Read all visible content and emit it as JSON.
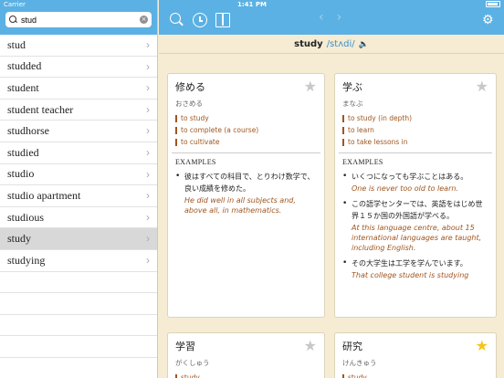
{
  "status": {
    "carrier": "Carrier",
    "time": "1:41 PM"
  },
  "search": {
    "value": "stud",
    "clear_glyph": "×"
  },
  "list_items": [
    "stud",
    "studded",
    "student",
    "student teacher",
    "studhorse",
    "studied",
    "studio",
    "studio apartment",
    "studious",
    "study",
    "studying"
  ],
  "selected_index": 9,
  "toolbar": {
    "back": "‹",
    "forward": "›",
    "gear": "⚙"
  },
  "word": {
    "headword": "study",
    "ipa": "/stʌdi/",
    "speaker": "🔈"
  },
  "cards": [
    {
      "head": "修める",
      "reading": "おさめる",
      "starred": false,
      "defs": [
        "to study",
        "to complete (a course)",
        "to cultivate"
      ],
      "examples_title": "EXAMPLES",
      "examples": [
        {
          "jp": "彼はすべての科目で、とりわけ数学で、良い成績を修めた。",
          "en": "He did well in all subjects and, above all, in mathematics."
        }
      ]
    },
    {
      "head": "学ぶ",
      "reading": "まなぶ",
      "starred": false,
      "defs": [
        "to study (in depth)",
        "to learn",
        "to take lessons in"
      ],
      "examples_title": "EXAMPLES",
      "examples": [
        {
          "jp": "いくつになっても学ぶことはある。",
          "en": "One is never too old to learn."
        },
        {
          "jp": "この語学センターでは、英語をはじめ世界１５か国の外国語が学べる。",
          "en": "At this language centre, about 15 international languages are taught, including English."
        },
        {
          "jp": "その大学生は工学を学んでいます。",
          "en": "That college student is studying"
        }
      ]
    },
    {
      "head": "学習",
      "reading": "がくしゅう",
      "starred": false,
      "defs": [
        "study"
      ]
    },
    {
      "head": "研究",
      "reading": "けんきゅう",
      "starred": true,
      "defs": [
        "study"
      ]
    }
  ],
  "star_glyph": "★"
}
